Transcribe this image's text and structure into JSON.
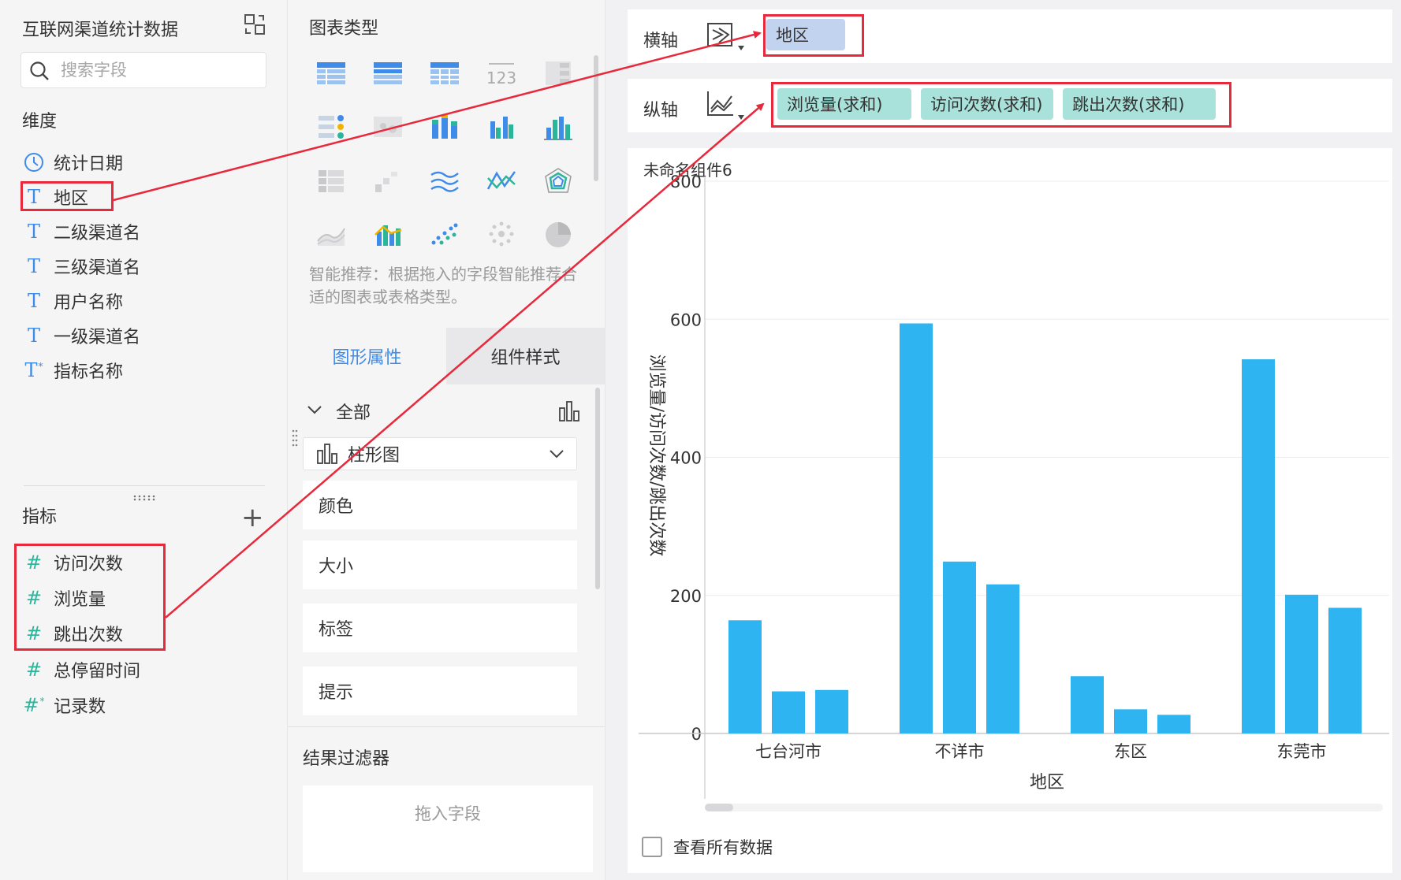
{
  "left_panel": {
    "dataset_title": "互联网渠道统计数据",
    "search_placeholder": "搜索字段",
    "dimensions_title": "维度",
    "dimensions": [
      {
        "label": "统计日期",
        "icon": "clock-icon"
      },
      {
        "label": "地区",
        "icon": "text-type-icon"
      },
      {
        "label": "二级渠道名",
        "icon": "text-type-icon"
      },
      {
        "label": "三级渠道名",
        "icon": "text-type-icon"
      },
      {
        "label": "用户名称",
        "icon": "text-type-icon"
      },
      {
        "label": "一级渠道名",
        "icon": "text-type-icon"
      },
      {
        "label": "指标名称",
        "icon": "text-calculated-icon"
      }
    ],
    "measures_title": "指标",
    "measures": [
      {
        "label": "访问次数",
        "icon": "number-type-icon"
      },
      {
        "label": "浏览量",
        "icon": "number-type-icon"
      },
      {
        "label": "跳出次数",
        "icon": "number-type-icon"
      },
      {
        "label": "总停留时间",
        "icon": "number-type-icon"
      },
      {
        "label": "记录数",
        "icon": "number-calculated-icon"
      }
    ]
  },
  "middle_panel": {
    "chart_type_title": "图表类型",
    "smart_tip": "智能推荐：根据拖入的字段智能推荐合适的图表或表格类型。",
    "tabs": {
      "graph_props": "图形属性",
      "component_style": "组件样式"
    },
    "all_label": "全部",
    "chart_type_selected": "柱形图",
    "properties": [
      "颜色",
      "大小",
      "标签",
      "提示"
    ],
    "filter_title": "结果过滤器",
    "drop_placeholder": "拖入字段"
  },
  "right_panel": {
    "x_axis_label": "横轴",
    "y_axis_label": "纵轴",
    "x_fields": [
      "地区"
    ],
    "y_fields": [
      "浏览量(求和)",
      "访问次数(求和)",
      "跳出次数(求和)"
    ],
    "chart_title": "未命名组件6",
    "view_all_label": "查看所有数据"
  },
  "colors": {
    "accent": "#3f8be8",
    "bar": "#2eb4f0",
    "annotation_red": "#e8283b",
    "pill_blue": "#c2d3ef",
    "pill_teal": "#a9e2da"
  },
  "chart_data": {
    "type": "bar",
    "categories": [
      "七台河市",
      "不详市",
      "东区",
      "东莞市"
    ],
    "series": [
      {
        "name": "浏览量",
        "values": [
          164,
          594,
          83,
          542
        ]
      },
      {
        "name": "访问次数",
        "values": [
          61,
          249,
          35,
          201
        ]
      },
      {
        "name": "跳出次数",
        "values": [
          63,
          216,
          27,
          182
        ]
      }
    ],
    "xlabel": "地区",
    "ylabel": "浏览量/访问次数/跳出次数",
    "yticks": [
      0,
      200,
      400,
      600,
      800
    ],
    "ylim": [
      0,
      800
    ],
    "grid": true
  }
}
